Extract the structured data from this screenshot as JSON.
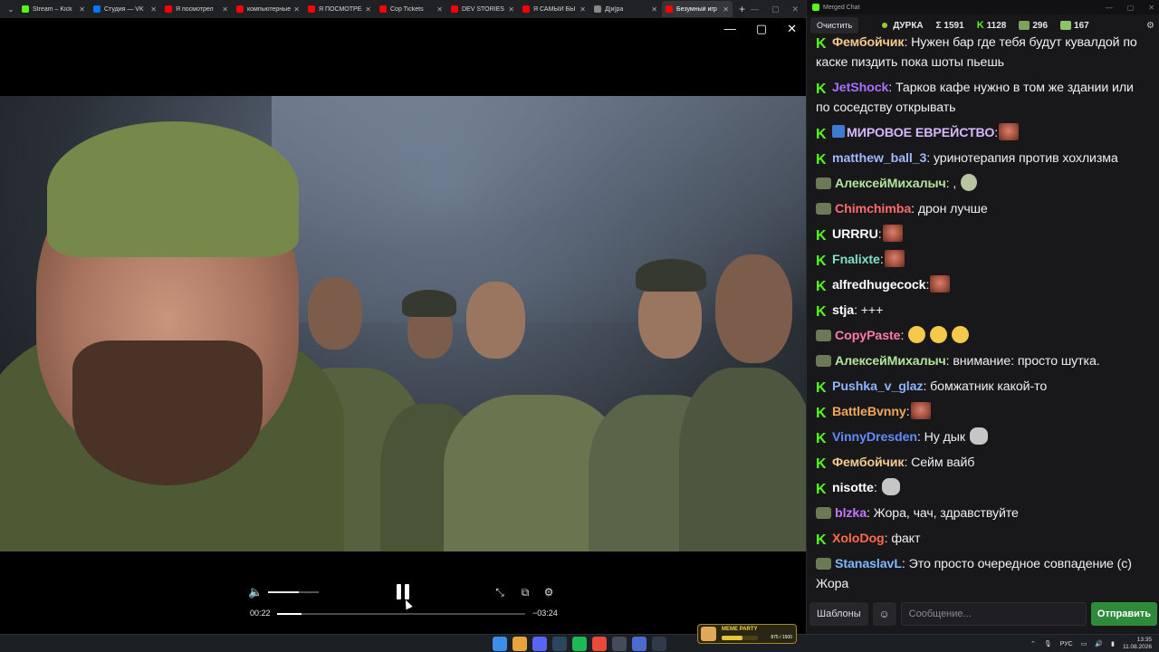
{
  "browser": {
    "tabs": [
      {
        "title": "Stream – Kick",
        "favicon_color": "#53fc18",
        "active": false
      },
      {
        "title": "Студия — VK",
        "favicon_color": "#0077ff",
        "active": false
      },
      {
        "title": "Я посмотрел",
        "favicon_color": "#ff0000",
        "active": false
      },
      {
        "title": "компьютерные",
        "favicon_color": "#ff0000",
        "active": false
      },
      {
        "title": "Я ПОСМОТРЕЛ",
        "favicon_color": "#ff0000",
        "active": false
      },
      {
        "title": "Cop Tickets",
        "favicon_color": "#ff0000",
        "active": false
      },
      {
        "title": "DEV STORIES",
        "favicon_color": "#ff0000",
        "active": false
      },
      {
        "title": "Я САМЫЙ БЫ",
        "favicon_color": "#ff0000",
        "active": false
      },
      {
        "title": "Д[и]ра",
        "favicon_color": "#888888",
        "active": false
      },
      {
        "title": "Безумный игр",
        "favicon_color": "#ff0000",
        "active": true
      }
    ],
    "new_tab_icon": "plus-icon"
  },
  "player": {
    "time_current": "00:22",
    "time_remaining": "−03:24",
    "progress_fraction": 0.097,
    "volume_fraction": 0.6,
    "state": "playing"
  },
  "chat": {
    "window_title": "Merged Chat",
    "clear_label": "Очистить",
    "channel": "ДУРКА",
    "total_viewers": "Σ 1591",
    "kick_viewers": "1128",
    "twitch_viewers": "296",
    "other_viewers": "167",
    "messages": [
      {
        "platform": "kick",
        "user": "Фембойчик",
        "color": "#f2c98a",
        "text": "Нужен бар где тебя будут кувалдой по каске пиздить пока шоты пьешь",
        "emotes": []
      },
      {
        "platform": "kick",
        "user": "JetShock",
        "color": "#a970ff",
        "text": "Тарков кафе нужно в том же здании или по соседству открывать",
        "emotes": []
      },
      {
        "platform": "kick",
        "user": "МИРОВОЕ ЕВРЕЙСТВО",
        "color": "#d7b8ff",
        "text": "",
        "emotes": [
          "face"
        ],
        "pick_badge": true
      },
      {
        "platform": "kick",
        "user": "matthew_ball_3",
        "color": "#9fb8ff",
        "text": "уринотерапия против хохлизма",
        "emotes": []
      },
      {
        "platform": "twitch",
        "user": "АлексейМихалыч",
        "color": "#b3e59a",
        "text": ",",
        "emotes": [
          "peek"
        ]
      },
      {
        "platform": "twitch",
        "user": "Chimchimba",
        "color": "#ff6b6b",
        "text": "дрон лучше",
        "emotes": []
      },
      {
        "platform": "kick",
        "user": "URRRU",
        "color": "#ffffff",
        "text": "",
        "emotes": [
          "face"
        ]
      },
      {
        "platform": "kick",
        "user": "Fnalixte",
        "color": "#7fe0c8",
        "text": "",
        "emotes": [
          "face"
        ]
      },
      {
        "platform": "kick",
        "user": "alfredhugecock",
        "color": "#ffffff",
        "text": "",
        "emotes": [
          "face"
        ]
      },
      {
        "platform": "kick",
        "user": "stja",
        "color": "#ffffff",
        "text": "+++",
        "emotes": []
      },
      {
        "platform": "twitch",
        "user": "CopyPaste",
        "color": "#ff7aa8",
        "text": "",
        "emotes": [
          "cry",
          "cry",
          "cry"
        ]
      },
      {
        "platform": "twitch",
        "user": "АлексейМихалыч",
        "color": "#b3e59a",
        "text": "внимание: просто шутка.",
        "emotes": []
      },
      {
        "platform": "kick",
        "user": "Pushka_v_glaz",
        "color": "#8fb4ff",
        "text": "бомжатник какой-то",
        "emotes": []
      },
      {
        "platform": "kick",
        "user": "BattleBvnny",
        "color": "#f2a65a",
        "text": "",
        "emotes": [
          "face"
        ]
      },
      {
        "platform": "kick",
        "user": "VinnyDresden",
        "color": "#5f8cff",
        "text": "Ну дык",
        "emotes": [
          "cat"
        ]
      },
      {
        "platform": "kick",
        "user": "Фембойчик",
        "color": "#f2c98a",
        "text": "Сейм вайб",
        "emotes": []
      },
      {
        "platform": "kick",
        "user": "nisotte",
        "color": "#ffffff",
        "text": "",
        "emotes": [
          "cat"
        ]
      },
      {
        "platform": "twitch",
        "user": "blzka",
        "color": "#c774ff",
        "text": "Жора, чач, здравствуйте",
        "emotes": []
      },
      {
        "platform": "kick",
        "user": "XoloDog",
        "color": "#ff6b4a",
        "text": "факт",
        "emotes": []
      },
      {
        "platform": "twitch",
        "user": "StanaslavL",
        "color": "#7db8ff",
        "text": "Это просто очередное совпадение (с) Жора",
        "emotes": []
      }
    ],
    "templates_label": "Шаблоны",
    "input_placeholder": "Сообщение...",
    "send_label": "Отправить"
  },
  "taskbar": {
    "meme_title": "MEME PARTY",
    "meme_progress": "875 / 1500",
    "meme_fraction": 0.583,
    "language": "РУС",
    "time": "13:35",
    "date": "11.08.2026",
    "app_icons": [
      {
        "name": "windows-start-icon",
        "color": "#3a8fe8"
      },
      {
        "name": "chrome-icon",
        "color": "#e8a33a"
      },
      {
        "name": "discord-icon",
        "color": "#5865f2"
      },
      {
        "name": "steam-icon",
        "color": "#2a475e"
      },
      {
        "name": "spotify-icon",
        "color": "#1db954"
      },
      {
        "name": "git-icon",
        "color": "#e84a3a"
      },
      {
        "name": "obs-icon",
        "color": "#444c5c"
      },
      {
        "name": "browser-icon",
        "color": "#4a6cd1"
      },
      {
        "name": "app-icon",
        "color": "#2f3b4a"
      }
    ]
  }
}
